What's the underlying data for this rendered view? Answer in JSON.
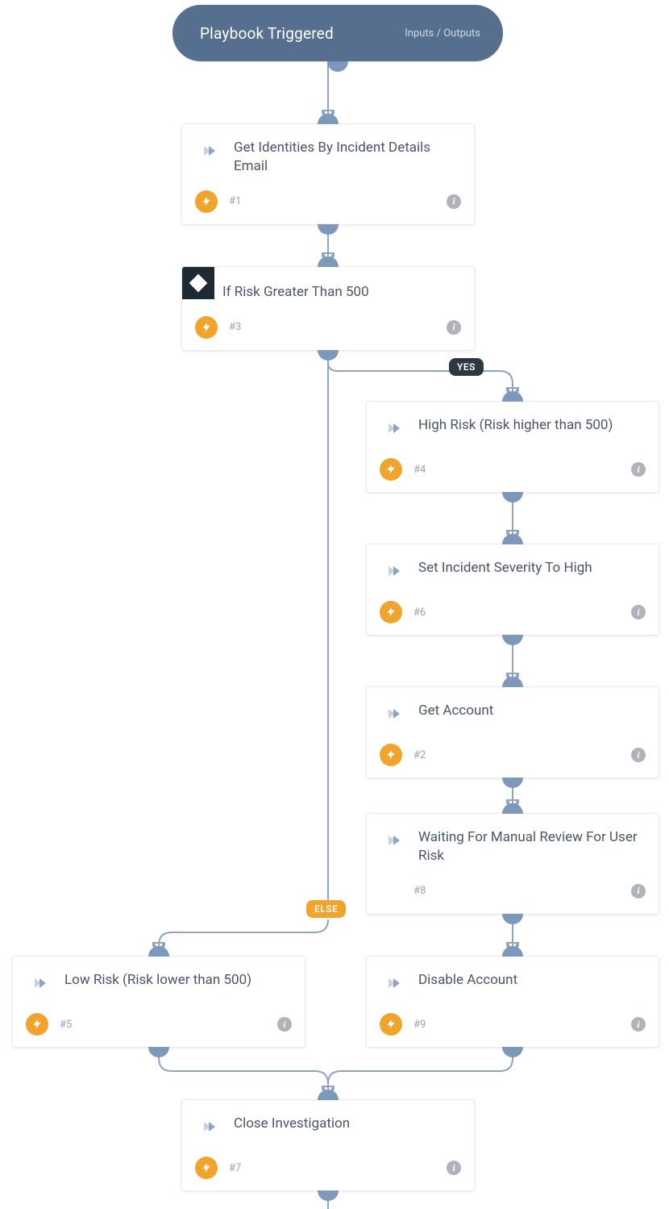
{
  "trigger": {
    "title": "Playbook Triggered",
    "io_label": "Inputs / Outputs"
  },
  "branch_labels": {
    "yes": "YES",
    "else": "ELSE"
  },
  "cards": {
    "c1": {
      "title": "Get Identities By Incident Details Email",
      "step": "#1"
    },
    "c3": {
      "title": "If Risk Greater Than 500",
      "step": "#3"
    },
    "c4": {
      "title": "High Risk (Risk higher than 500)",
      "step": "#4"
    },
    "c6": {
      "title": "Set Incident Severity To High",
      "step": "#6"
    },
    "c2": {
      "title": "Get Account",
      "step": "#2"
    },
    "c8": {
      "title": "Waiting For Manual Review For User Risk",
      "step": "#8"
    },
    "c5": {
      "title": "Low Risk (Risk lower than 500)",
      "step": "#5"
    },
    "c9": {
      "title": "Disable Account",
      "step": "#9"
    },
    "c7": {
      "title": "Close Investigation",
      "step": "#7"
    }
  }
}
